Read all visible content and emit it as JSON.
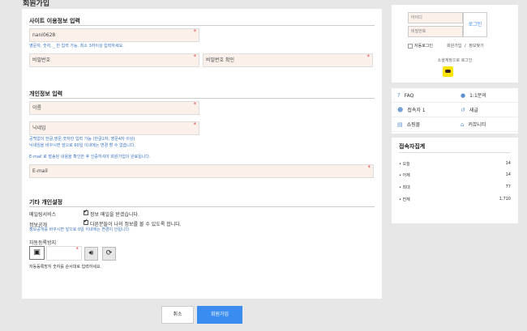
{
  "page": {
    "title": "회원가입"
  },
  "site_section": {
    "title": "사이트 이용정보 입력",
    "userid_value": "nani0628",
    "userid_hint": "영문자, 숫자, _ 만 입력 가능. 최소 3자이상 입력하세요.",
    "password_placeholder": "비밀번호",
    "password_confirm_placeholder": "비밀번호 확인"
  },
  "personal_section": {
    "title": "개인정보 입력",
    "name_placeholder": "이름",
    "nickname_placeholder": "닉네임",
    "nickname_hint1": "공백없이 한글,영문,숫자만 입력 가능 (한글2자, 영문4자 이상)",
    "nickname_hint2": "닉네임을 바꾸시면 앞으로 60일 이내에는 변경 할 수 없습니다.",
    "email_hint": "E-mail 로 발송된 내용을 확인한 후 인증하셔야 회원가입이 완료됩니다.",
    "email_placeholder": "E-mail"
  },
  "other_section": {
    "title": "기타 개인설정",
    "mailing_label": "메일링서비스",
    "mailing_option": "정보 메일을 받겠습니다.",
    "open_label": "정보공개",
    "open_option": "다른분들이 나의 정보를 볼 수 있도록 합니다.",
    "open_hint": "정보공개를 바꾸시면 앞으로 0일 이내에는 변경이 안됩니다.",
    "captcha_label": "자동등록방지",
    "captcha_hint": "자동등록방지 숫자를 순서대로 입력하세요."
  },
  "actions": {
    "cancel": "취소",
    "submit": "회원가입"
  },
  "login": {
    "id_placeholder": "아이디",
    "pw_placeholder": "비밀번호",
    "login_button": "로그인",
    "auto_login": "자동로그인",
    "join": "회원가입",
    "separator": "/",
    "find": "정보찾기",
    "social_title": "소셜계정으로 로그인"
  },
  "menu": {
    "faq": "FAQ",
    "qna": "1:1문의",
    "visitors": "접속자 1",
    "new": "새글",
    "shop": "쇼핑몰",
    "community": "커뮤니티"
  },
  "stats": {
    "title": "접속자집계",
    "rows": [
      {
        "label": "오늘",
        "value": "14"
      },
      {
        "label": "어제",
        "value": "14"
      },
      {
        "label": "최대",
        "value": "77"
      },
      {
        "label": "전체",
        "value": "1,710"
      }
    ]
  },
  "colors": {
    "primary": "#3b8cf0",
    "field_bg": "#fbf1ea",
    "required": "#e03a3a",
    "hint": "#3b74c5",
    "kakao": "#fee500"
  }
}
